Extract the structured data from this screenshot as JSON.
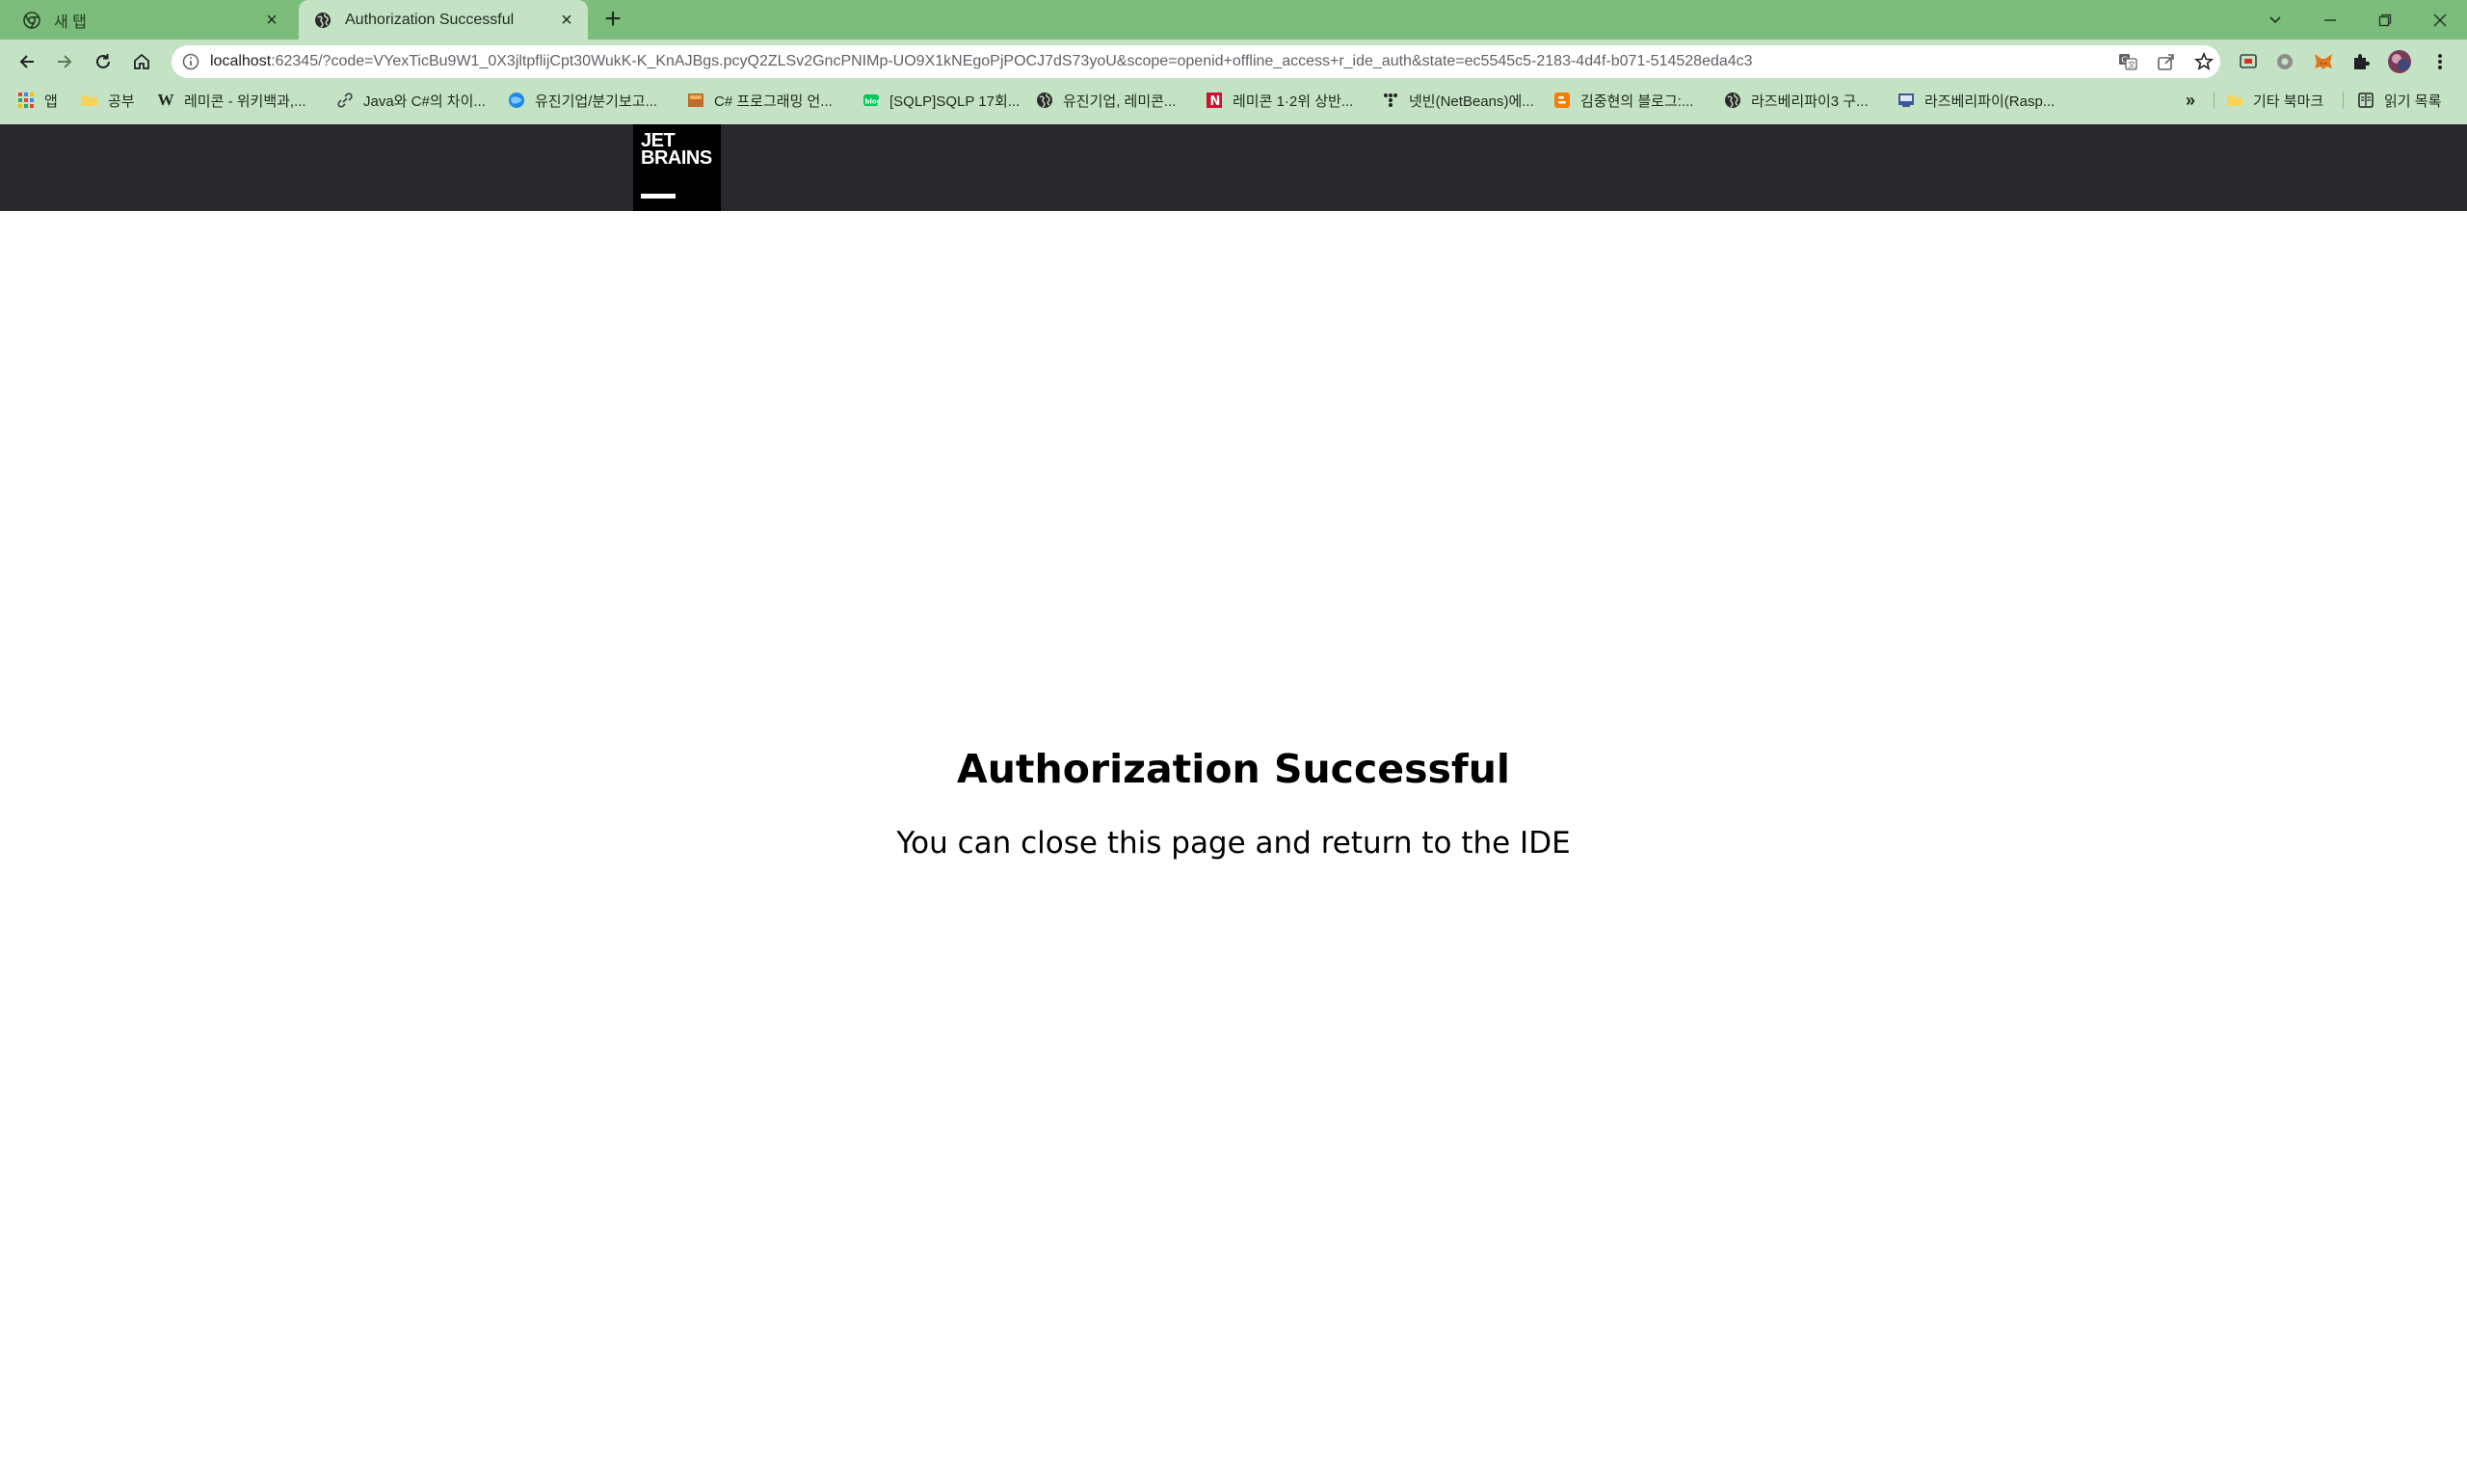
{
  "browser": {
    "tabs": [
      {
        "title": "새 탭",
        "icon": "chrome-icon",
        "active": false
      },
      {
        "title": "Authorization Successful",
        "icon": "globe-icon",
        "active": true
      }
    ],
    "new_tab_label": "+",
    "address": {
      "host": "localhost",
      "rest": ":62345/?code=VYexTicBu9W1_0X3jltpflijCpt30WukK-K_KnAJBgs.pcyQ2ZLSv2GncPNIMp-UO9X1kNEgoPjPOCJ7dS73yoU&scope=openid+offline_access+r_ide_auth&state=ec5545c5-2183-4d4f-b071-514528eda4c3"
    },
    "bookmarks": [
      {
        "label": "앱",
        "icon": "apps-grid-icon"
      },
      {
        "label": "공부",
        "icon": "folder-icon"
      },
      {
        "label": "레미콘 - 위키백과,...",
        "icon": "wikipedia-icon"
      },
      {
        "label": "Java와 C#의 차이...",
        "icon": "link-icon"
      },
      {
        "label": "유진기업/분기보고...",
        "icon": "blue-globe-icon"
      },
      {
        "label": "C# 프로그래밍 언...",
        "icon": "book-icon"
      },
      {
        "label": "[SQLP]SQLP 17회...",
        "icon": "blog-icon"
      },
      {
        "label": "유진기업, 레미콘...",
        "icon": "globe-icon"
      },
      {
        "label": "레미콘 1·2위 상반...",
        "icon": "news-icon"
      },
      {
        "label": "넷빈(NetBeans)에...",
        "icon": "tistory-icon"
      },
      {
        "label": "김중현의 블로그:...",
        "icon": "blogger-icon"
      },
      {
        "label": "라즈베리파이3 구...",
        "icon": "globe-icon"
      },
      {
        "label": "라즈베리파이(Rasp...",
        "icon": "site-icon"
      }
    ],
    "bookmarks_more": "»",
    "other_bookmarks": "기타 북마크",
    "reading_list": "읽기 목록"
  },
  "page": {
    "logo_text_line1": "JET",
    "logo_text_line2": "BRAINS",
    "title": "Authorization Successful",
    "subtitle": "You can close this page and return to the IDE"
  }
}
